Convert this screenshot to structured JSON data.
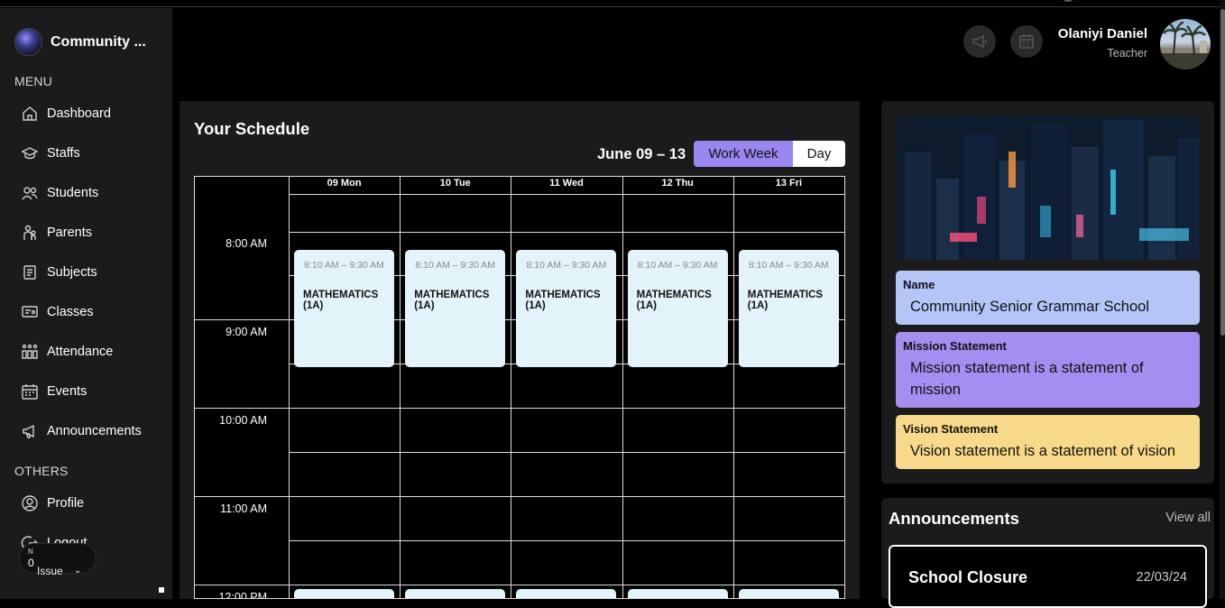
{
  "sidebar": {
    "brand": "Community ...",
    "menu_label": "MENU",
    "menu_items": [
      {
        "label": "Dashboard",
        "icon": "home-icon"
      },
      {
        "label": "Staffs",
        "icon": "graduation-cap-icon"
      },
      {
        "label": "Students",
        "icon": "users-icon"
      },
      {
        "label": "Parents",
        "icon": "parents-icon"
      },
      {
        "label": "Subjects",
        "icon": "book-icon"
      },
      {
        "label": "Classes",
        "icon": "classroom-icon"
      },
      {
        "label": "Attendance",
        "icon": "attendance-grid-icon"
      },
      {
        "label": "Events",
        "icon": "calendar-icon"
      },
      {
        "label": "Announcements",
        "icon": "megaphone-icon"
      }
    ],
    "others_label": "OTHERS",
    "other_items": [
      {
        "label": "Profile",
        "icon": "user-circle-icon"
      },
      {
        "label": "Logout",
        "icon": "logout-icon"
      }
    ],
    "issue_widget": {
      "n": "N",
      "count": "0",
      "label": "Issue"
    }
  },
  "header": {
    "user_name": "Olaniyi Daniel",
    "user_role": "Teacher"
  },
  "schedule": {
    "title": "Your Schedule",
    "range": "June 09 – 13",
    "view_work_week": "Work Week",
    "view_day": "Day",
    "days": [
      "09 Mon",
      "10 Tue",
      "11 Wed",
      "12 Thu",
      "13 Fri"
    ],
    "times": [
      "8:00 AM",
      "9:00 AM",
      "10:00 AM",
      "11:00 AM",
      "12:00 PM"
    ],
    "events": [
      {
        "time": "8:10 AM – 9:30 AM",
        "title": "MATHEMATICS (1A)"
      },
      {
        "time": "8:10 AM – 9:30 AM",
        "title": "MATHEMATICS (1A)"
      },
      {
        "time": "8:10 AM – 9:30 AM",
        "title": "MATHEMATICS (1A)"
      },
      {
        "time": "8:10 AM – 9:30 AM",
        "title": "MATHEMATICS (1A)"
      },
      {
        "time": "8:10 AM – 9:30 AM",
        "title": "MATHEMATICS (1A)"
      }
    ]
  },
  "school": {
    "name_label": "Name",
    "name_value": "Community Senior Grammar School",
    "mission_label": "Mission Statement",
    "mission_value": "Mission statement is a statement of mission",
    "vision_label": "Vision Statement",
    "vision_value": "Vision statement is a statement of vision",
    "colors": {
      "name_card": "#b3c6f7",
      "mission_card": "#a48ef0",
      "vision_card": "#f8d98a"
    }
  },
  "announcements": {
    "title": "Announcements",
    "view_all": "View all",
    "items": [
      {
        "title": "School Closure",
        "date": "22/03/24"
      }
    ]
  }
}
